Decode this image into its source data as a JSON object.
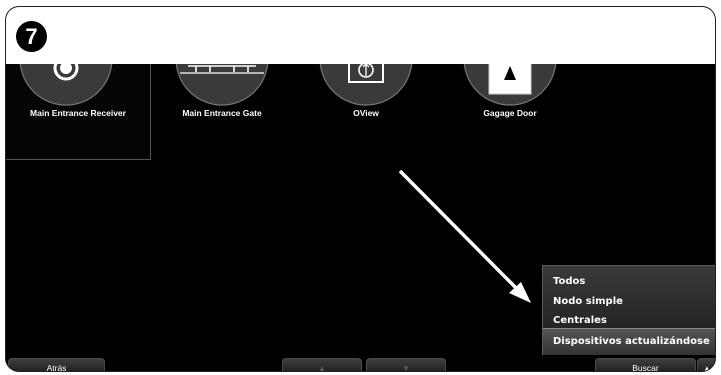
{
  "step_number": "7",
  "devices": [
    {
      "label": "Main Entrance Receiver",
      "icon": "receiver-icon"
    },
    {
      "label": "Main Entrance Gate",
      "icon": "gate-icon"
    },
    {
      "label": "OView",
      "icon": "oview-icon"
    },
    {
      "label": "Gagage Door",
      "icon": "garage-door-icon"
    }
  ],
  "filter_menu": {
    "items": [
      "Todos",
      "Nodo simple",
      "Centrales"
    ],
    "highlighted": "Dispositivos actualizándose"
  },
  "bottom_bar": {
    "back_label": "Atrás",
    "scroll_up": "▲",
    "scroll_down": "▼",
    "search_label": "Buscar",
    "menu_toggle": "▲"
  },
  "colors": {
    "background": "#000000",
    "text": "#ffffff",
    "tile_icon": "#3a3a3a"
  }
}
